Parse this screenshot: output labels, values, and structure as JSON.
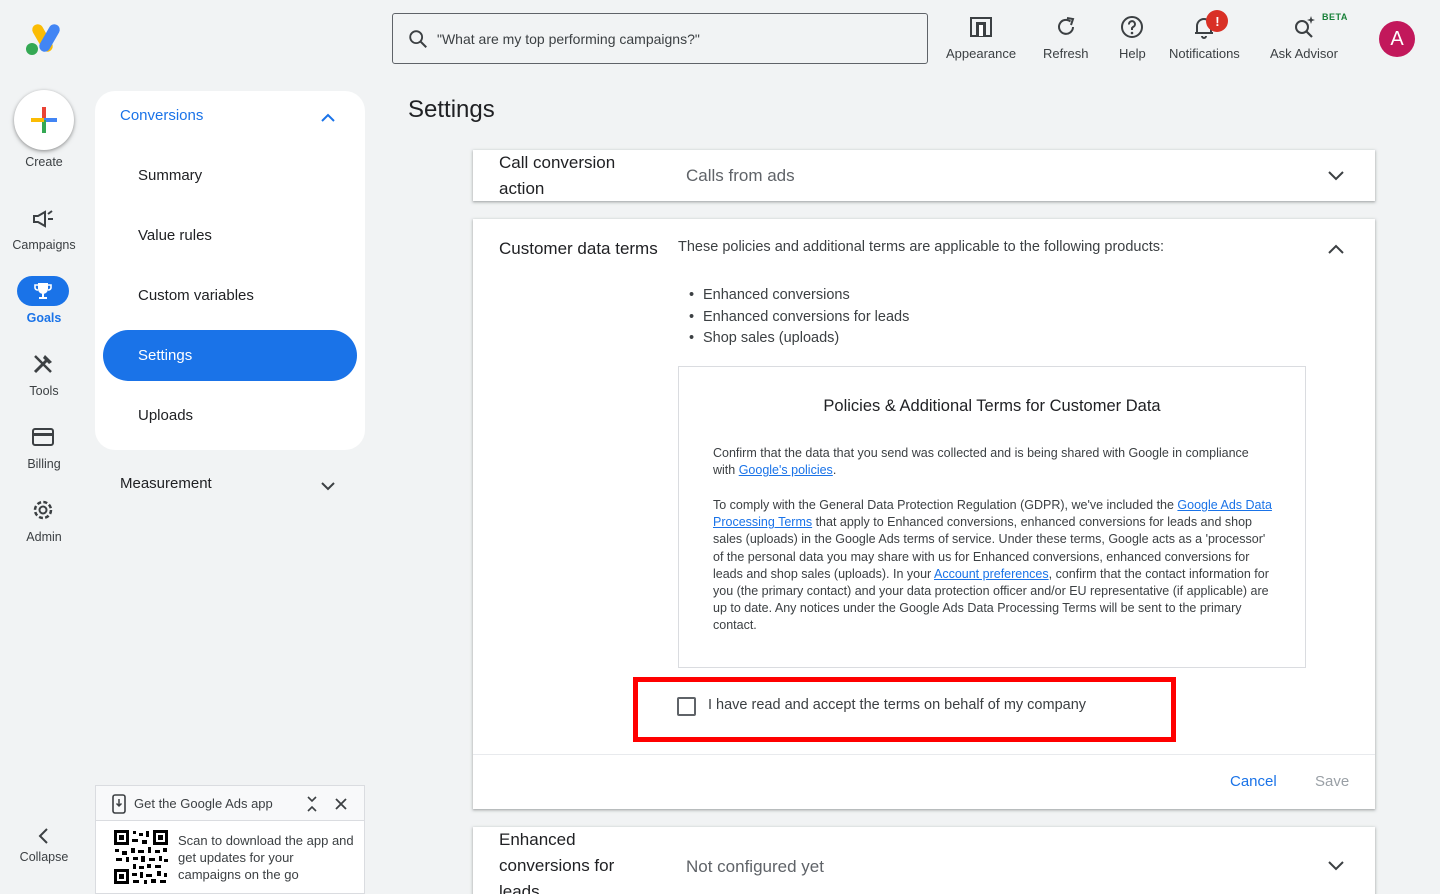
{
  "app": {
    "brand_colors": [
      "#fbbc04",
      "#4285f4",
      "#34a853"
    ]
  },
  "search": {
    "placeholder": "\"What are my top performing campaigns?\""
  },
  "toolbar": {
    "appearance": "Appearance",
    "refresh": "Refresh",
    "help": "Help",
    "notifications": "Notifications",
    "notifications_badge": "!",
    "ask_advisor": "Ask Advisor",
    "beta": "BETA",
    "avatar_initial": "A"
  },
  "rail": {
    "create": "Create",
    "campaigns": "Campaigns",
    "goals": "Goals",
    "tools": "Tools",
    "billing": "Billing",
    "admin": "Admin",
    "collapse": "Collapse"
  },
  "nav": {
    "section": "Conversions",
    "items": [
      {
        "label": "Summary"
      },
      {
        "label": "Value rules"
      },
      {
        "label": "Custom variables"
      },
      {
        "label": "Settings"
      },
      {
        "label": "Uploads"
      }
    ],
    "measurement": "Measurement"
  },
  "promo": {
    "title": "Get the Google Ads app",
    "text": "Scan to download the app and get updates for your campaigns on the go"
  },
  "main": {
    "title": "Settings",
    "call_card": {
      "label": "Call conversion action",
      "value": "Calls from ads"
    },
    "terms_card": {
      "label": "Customer data terms",
      "intro": "These policies and additional terms are applicable to the following products:",
      "products": [
        "Enhanced conversions",
        "Enhanced conversions for leads",
        "Shop sales (uploads)"
      ],
      "policy_title": "Policies & Additional Terms for Customer Data",
      "p1_text": "Confirm that the data that you send was collected and is being shared with Google in compliance with ",
      "p1_link": "Google's policies",
      "p1_end": ".",
      "p2_a": "To comply with the General Data Protection Regulation (GDPR), we've included the ",
      "p2_link1": "Google Ads Data Processing Terms",
      "p2_b": " that apply to Enhanced conversions, enhanced conversions for leads and shop sales (uploads) in the Google Ads terms of service. Under these terms, Google acts as a 'processor' of the personal data you may share with us for Enhanced conversions, enhanced conversions for leads and shop sales (uploads). In your ",
      "p2_link2": "Account preferences",
      "p2_c": ", confirm that the contact information for you (the primary contact) and your data protection officer and/or EU representative (if applicable) are up to date. Any notices under the Google Ads Data Processing Terms will be sent to the primary contact.",
      "accept_label": "I have read and accept the terms on behalf of my company",
      "cancel": "Cancel",
      "save": "Save"
    },
    "enhanced_card": {
      "label": "Enhanced conversions for leads",
      "value": "Not configured yet"
    }
  }
}
